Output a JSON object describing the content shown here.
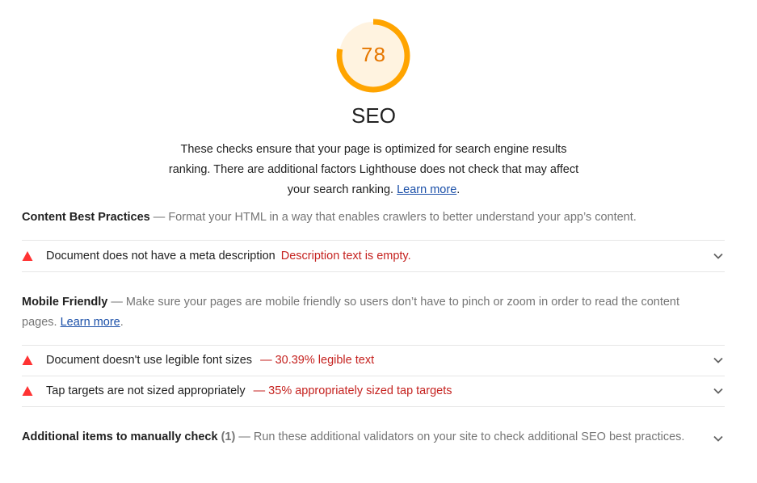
{
  "gauge": {
    "score": "78",
    "fraction": 0.78,
    "color": "#ffa400",
    "bg_color": "#fff3e0"
  },
  "category": {
    "title": "SEO",
    "description": "These checks ensure that your page is optimized for search engine results ranking. There are additional factors Lighthouse does not check that may affect your search ranking.",
    "learn_more": "Learn more",
    "period": "."
  },
  "groups": [
    {
      "title": "Content Best Practices",
      "separator": " — ",
      "description": "Format your HTML in a way that enables crawlers to better understand your app’s content.",
      "audits": [
        {
          "title": "Document does not have a meta description",
          "display": "Description text is empty."
        }
      ]
    },
    {
      "title": "Mobile Friendly",
      "separator": " — ",
      "description": "Make sure your pages are mobile friendly so users don’t have to pinch or zoom in order to read the content pages.",
      "learn_more": "Learn more",
      "period": ".",
      "audits": [
        {
          "title": "Document doesn't use legible font sizes",
          "display": "— 30.39% legible text"
        },
        {
          "title": "Tap targets are not sized appropriately",
          "display": "— 35% appropriately sized tap targets"
        }
      ]
    },
    {
      "title": "Additional items to manually check",
      "count": "(1)",
      "separator": " — ",
      "description": "Run these additional validators on your site to check additional SEO best practices."
    }
  ],
  "colors": {
    "fail": "#f33",
    "fail_text": "#c5221f",
    "link": "#1a4fa8"
  },
  "icons": {
    "fail": "triangle-warning-icon",
    "expand": "chevron-down-icon"
  }
}
